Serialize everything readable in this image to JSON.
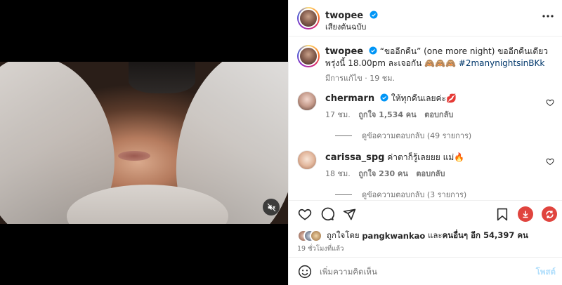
{
  "post": {
    "author": "twopee",
    "audio": "เสียงต้นฉบับ",
    "caption_user": "twopee",
    "caption_text": "“ขออีกคืน” (one more night) ขออีกคืนเดียว พรุ่งนี้ 18.00pm ละเจอกัน 🙈🙈🙈",
    "caption_hashtag": "#2manynightsinBKk",
    "caption_meta": "มีการแก้ไข · 19 ชม."
  },
  "comments": [
    {
      "user": "chermarn",
      "text": "ให้ทุกคืนเลยค่ะ💋",
      "age": "17 ชม.",
      "likes": "ถูกใจ 1,534 คน",
      "reply": "ตอบกลับ",
      "view_replies": "ดูข้อความตอบกลับ (49 รายการ)"
    },
    {
      "user": "carissa_spg",
      "text": "ค่าตาก็รู้เลยยย แม่🔥",
      "age": "18 ชม.",
      "likes": "ถูกใจ 230 คน",
      "reply": "ตอบกลับ",
      "view_replies": "ดูข้อความตอบกลับ (3 รายการ)"
    }
  ],
  "likes": {
    "prefix": "ถูกใจโดย",
    "user": "pangkwankao",
    "middle": "และ",
    "others": "คนอื่นๆ อีก 54,397 คน"
  },
  "time_ago": "19 ชั่วโมงที่แล้ว",
  "add_comment": {
    "placeholder": "เพิ่มความคิดเห็น",
    "post_label": "โพสต์"
  },
  "colors": {
    "verified": "#0095f6",
    "hashtag": "#00376b",
    "download_ext": "#e0443e",
    "repost_ext": "#e0443e",
    "post_button": "#b2dffc"
  },
  "icons": [
    "verified-icon",
    "more-options-icon",
    "heart-icon",
    "comment-icon",
    "share-icon",
    "bookmark-icon",
    "download-icon",
    "repost-icon",
    "emoji-icon",
    "mute-icon"
  ]
}
